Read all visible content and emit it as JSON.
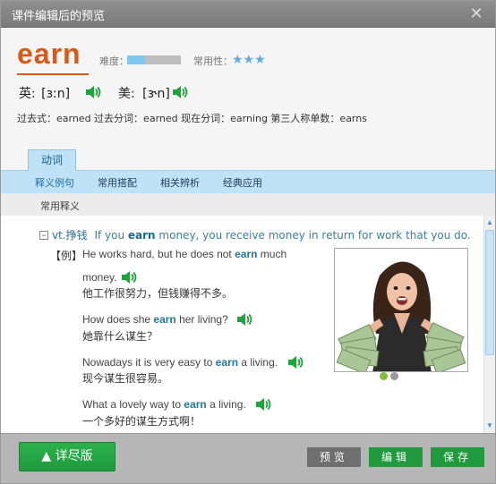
{
  "window": {
    "title": "课件编辑后的预览",
    "close_glyph": "✕"
  },
  "word": {
    "headword": "earn",
    "difficulty_label": "难度：",
    "difficulty_level": 0.33,
    "frequency_label": "常用性：",
    "frequency_stars": "★★★",
    "uk_label": "英:",
    "uk_ipa": "[ɜːn]",
    "us_label": "美:",
    "us_ipa": "[ɝn]",
    "forms": "过去式：earned 过去分词：earned 现在分词：earning 第三人称单数：earns"
  },
  "tabs": {
    "active": "动词"
  },
  "subnav": {
    "items": [
      "释义例句",
      "常用搭配",
      "相关辨析",
      "经典应用"
    ]
  },
  "section": {
    "label": "常用释义"
  },
  "definition": {
    "collapse_glyph": "−",
    "pos": "vt.挣钱",
    "text_before": "If you ",
    "keyword": "earn",
    "text_after": " money, you receive money in return for work that you do."
  },
  "examples": {
    "tag": "【例】",
    "items": [
      {
        "pre": "He works hard, but he does not ",
        "kw": "earn",
        "post": " much",
        "post2": "money.",
        "zh": "他工作很努力，但钱赚得不多。"
      },
      {
        "pre": "How does she ",
        "kw": "earn",
        "post": " her living?",
        "zh": "她靠什么谋生？"
      },
      {
        "pre": "Nowadays it is very easy to ",
        "kw": "earn",
        "post": " a living.",
        "zh": "现今谋生很容易。"
      },
      {
        "pre": "What a lovely way to ",
        "kw": "earn",
        "post": " a living.",
        "zh": "一个多好的谋生方式啊！"
      }
    ]
  },
  "footer": {
    "detail_label": "▲ 详尽版",
    "preview_label": "预览",
    "edit_label": "编辑",
    "save_label": "保存"
  },
  "colors": {
    "headword": "#d85a1a",
    "accent_blue": "#bfe2f7",
    "speaker_green": "#1fa33b",
    "button_green": "#1f9a3d",
    "button_gray": "#6f6f6f"
  }
}
